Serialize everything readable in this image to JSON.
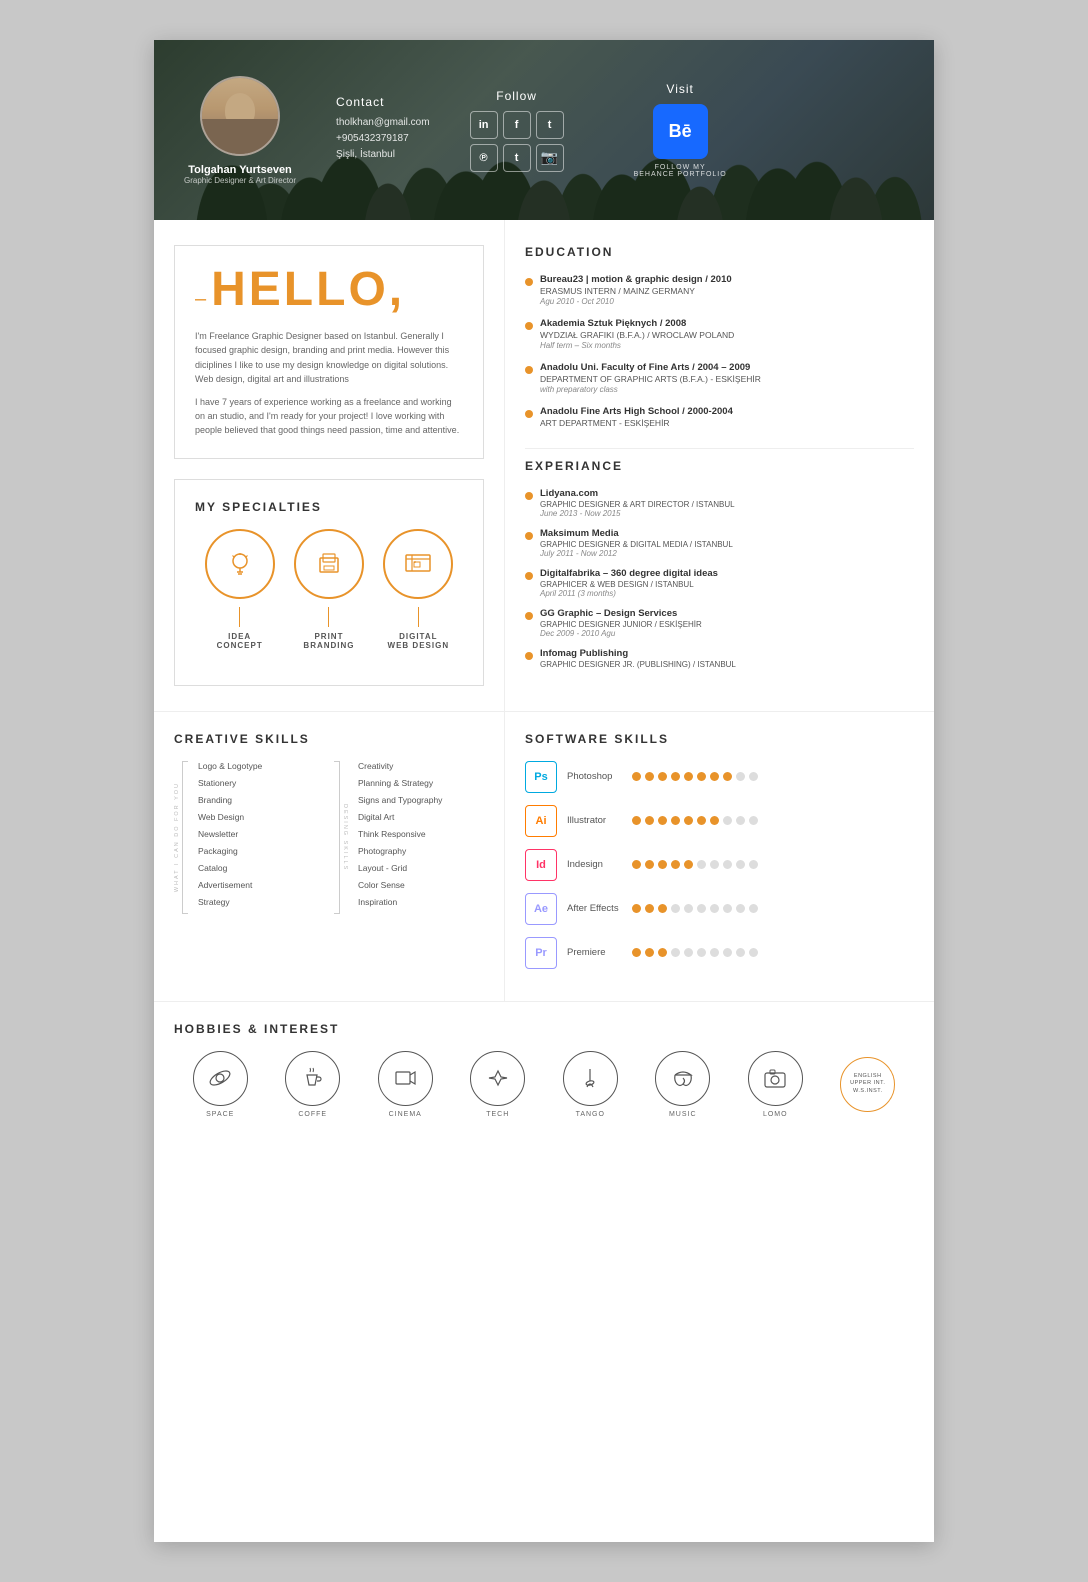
{
  "header": {
    "name": "Tolgahan Yurtseven",
    "title": "Graphic Designer & Art Director",
    "contact_label": "Contact",
    "email": "tholkhan@gmail.com",
    "phone": "+905432379187",
    "location": "Şişli, İstanbul",
    "follow_label": "Follow",
    "visit_label": "Visit",
    "behance_label": "FOLLOW MY\nBEHANCE PORTFOLIO",
    "social": [
      "in",
      "f",
      "t",
      "℗",
      "t",
      "📷"
    ]
  },
  "hello": {
    "greeting": "HELLO,",
    "bio1": "I'm Freelance Graphic Designer based on Istanbul. Generally I focused graphic design, branding and print media. However this diciplines I like to use my design knowledge on digital solutions. Web design, digital art and illustrations",
    "bio2": "I have 7 years of experience working as a freelance and working on an studio, and I'm ready for your project! I love working with people believed that good things need passion, time and attentive."
  },
  "specialties": {
    "title": "MY SPECIALTIES",
    "items": [
      {
        "label": "IDEA\nCONCEPT",
        "icon": "💡"
      },
      {
        "label": "PRINT\nBRANDING",
        "icon": "🖨"
      },
      {
        "label": "DIGITAL\nWEB DESIGN",
        "icon": "🖥"
      }
    ]
  },
  "education": {
    "title": "EDUCATION",
    "items": [
      {
        "degree": "Bureau23 | motion & graphic design / 2010",
        "institution": "ERASMUS INTERN / MAINZ GERMANY",
        "date": "Agu 2010 - Oct 2010"
      },
      {
        "degree": "Akademia Sztuk Pięknych / 2008",
        "institution": "WYDZIAŁ GRAFIKI (B.F.A.) / WROCLAW POLAND",
        "date": "Half term – Six months"
      },
      {
        "degree": "Anadolu Uni. Faculty of Fine Arts / 2004 – 2009",
        "institution": "DEPARTMENT OF GRAPHIC ARTS (B.F.A.) - ESKİŞEHİR",
        "date": "with preparatory class"
      },
      {
        "degree": "Anadolu Fine Arts High School / 2000-2004",
        "institution": "ART DEPARTMENT - ESKİŞEHİR",
        "date": ""
      }
    ]
  },
  "experience": {
    "title": "EXPERIANCE",
    "items": [
      {
        "company": "Lidyana.com",
        "role": "GRAPHIC DESIGNER & ART DIRECTOR / ISTANBUL",
        "date": "June 2013 - Now 2015"
      },
      {
        "company": "Maksimum Media",
        "role": "GRAPHIC DESIGNER & DIGITAL MEDIA / ISTANBUL",
        "date": "July 2011 - Now 2012"
      },
      {
        "company": "Digitalfabrika – 360 degree digital ideas",
        "role": "GRAPHICER & WEB DESIGN / ISTANBUL",
        "date": "April 2011 (3 months)"
      },
      {
        "company": "GG Graphic – Design Services",
        "role": "GRAPHIC DESIGNER JUNIOR / ESKİŞEHİR",
        "date": "Dec 2009 - 2010 Agu"
      },
      {
        "company": "Infomag Publishing",
        "role": "GRAPHIC DESIGNER JR. (PUBLISHING) / ISTANBUL",
        "date": ""
      }
    ]
  },
  "creative_skills": {
    "title": "CREATIVE SKILLS",
    "what_label": "WHAT I CAN DO FOR YOU",
    "design_label": "DESING SKILLS",
    "col1": [
      "Logo & Logotype",
      "Stationery",
      "Branding",
      "Web Design",
      "Newsletter",
      "Packaging",
      "Catalog",
      "Advertisement",
      "Strategy"
    ],
    "col2": [
      "Creativity",
      "Planning & Strategy",
      "Signs and Typography",
      "Digital Art",
      "Think Responsive",
      "Photography",
      "Layout - Grid",
      "Color Sense",
      "Inspiration"
    ]
  },
  "software_skills": {
    "title": "SOFTWARE SKILLS",
    "items": [
      {
        "name": "Photoshop",
        "abbr": "Ps",
        "filled": 8,
        "empty": 2
      },
      {
        "name": "Illustrator",
        "abbr": "Ai",
        "filled": 7,
        "empty": 3
      },
      {
        "name": "Indesign",
        "abbr": "Id",
        "filled": 5,
        "empty": 5
      },
      {
        "name": "After Effects",
        "abbr": "Ae",
        "filled": 3,
        "empty": 7
      },
      {
        "name": "Premiere",
        "abbr": "Pr",
        "filled": 3,
        "empty": 7
      }
    ]
  },
  "hobbies": {
    "title": "HOBBIES & INTEREST",
    "items": [
      {
        "label": "SPACE",
        "icon": "🔭"
      },
      {
        "label": "COFFE",
        "icon": "☕"
      },
      {
        "label": "CINEMA",
        "icon": "🎬"
      },
      {
        "label": "TECH",
        "icon": "🚀"
      },
      {
        "label": "TANGO",
        "icon": "👠"
      },
      {
        "label": "MUSIC",
        "icon": "🎧"
      },
      {
        "label": "LOMO",
        "icon": "📷"
      }
    ],
    "english": "ENGLISH\nUPPER INT.\nW.S.INST."
  }
}
